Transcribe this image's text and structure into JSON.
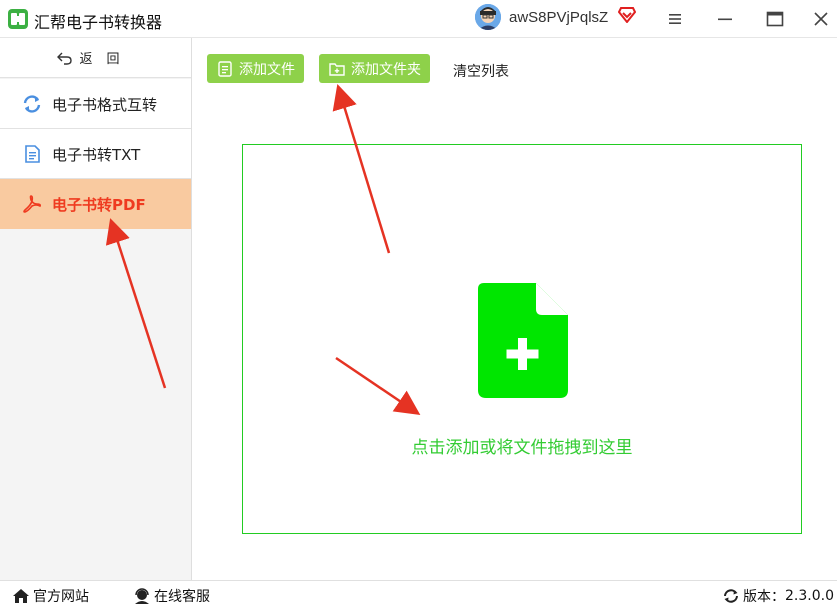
{
  "app": {
    "title": "汇帮电子书转换器",
    "username": "awS8PVjPqlsZ"
  },
  "sidebar": {
    "back_label": "返回",
    "items": [
      {
        "label": "电子书格式互转",
        "icon": "refresh-icon"
      },
      {
        "label": "电子书转TXT",
        "icon": "document-icon"
      },
      {
        "label": "电子书转PDF",
        "icon": "pdf-icon",
        "active": true
      }
    ]
  },
  "toolbar": {
    "add_file": "添加文件",
    "add_folder": "添加文件夹",
    "clear_list": "清空列表"
  },
  "dropzone": {
    "text": "点击添加或将文件拖拽到这里"
  },
  "statusbar": {
    "website": "官方网站",
    "service": "在线客服",
    "version_label": "版本：",
    "version": "2.3.0.0"
  },
  "colors": {
    "accent_green": "#8ed14a",
    "drop_green": "#00e600",
    "active_bg": "#f9caa0",
    "active_text": "#ef3b20",
    "arrow_red": "#e53323"
  }
}
